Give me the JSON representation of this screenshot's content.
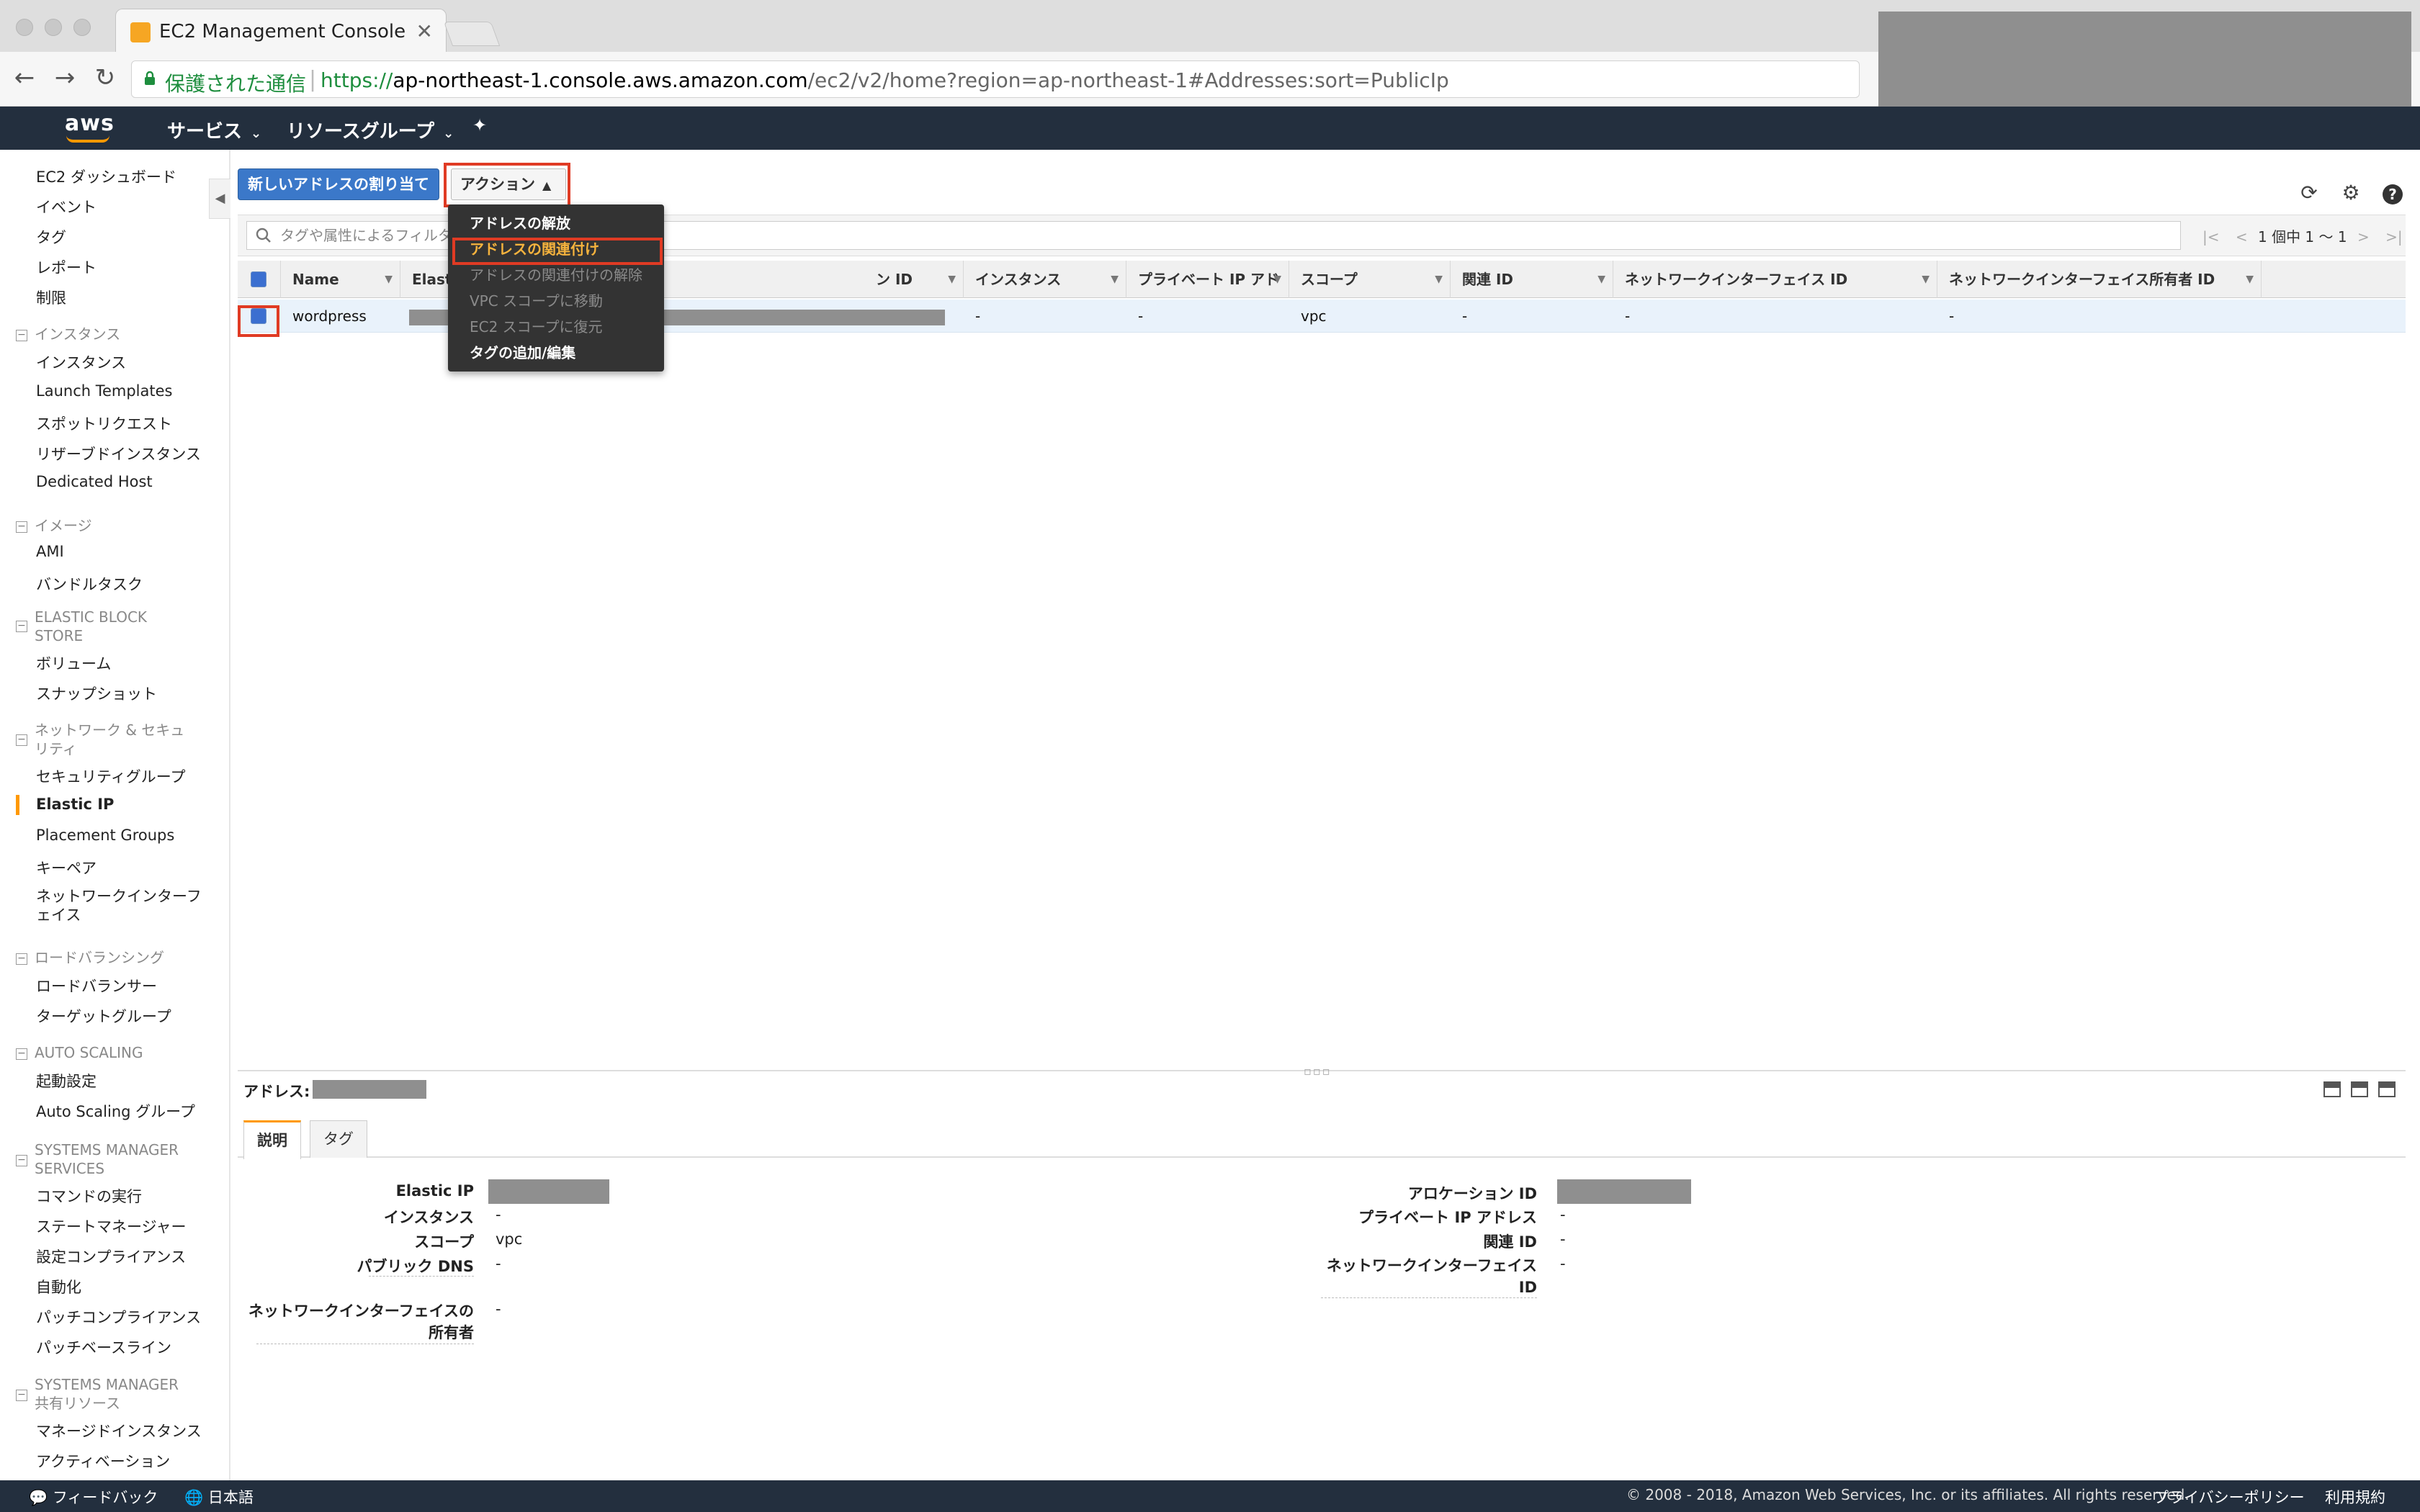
{
  "browser": {
    "tab_title": "EC2 Management Console",
    "secure_label": "保護された通信",
    "url_scheme": "https://",
    "url_host": "ap-northeast-1.console.aws.amazon.com",
    "url_path": "/ec2/v2/home?region=ap-northeast-1#Addresses:sort=PublicIp",
    "close_glyph": "✕"
  },
  "awsnav": {
    "logo": "aws",
    "services": "サービス",
    "resource_groups": "リソースグループ"
  },
  "sidebar": {
    "top_items": [
      "EC2 ダッシュボード",
      "イベント",
      "タグ",
      "レポート",
      "制限"
    ],
    "sections": [
      {
        "title": "インスタンス",
        "items": [
          "インスタンス",
          "Launch Templates",
          "スポットリクエスト",
          "リザーブドインスタンス",
          "Dedicated Host"
        ]
      },
      {
        "title": "イメージ",
        "items": [
          "AMI",
          "バンドルタスク"
        ]
      },
      {
        "title_lines": [
          "ELASTIC BLOCK",
          "STORE"
        ],
        "items": [
          "ボリューム",
          "スナップショット"
        ]
      },
      {
        "title_lines": [
          "ネットワーク & セキュ",
          "リティ"
        ],
        "items": [
          "セキュリティグループ",
          "Elastic IP",
          "Placement Groups",
          "キーペア"
        ],
        "extra_lines": [
          "ネットワークインターフ",
          "ェイス"
        ]
      },
      {
        "title": "ロードバランシング",
        "items": [
          "ロードバランサー",
          "ターゲットグループ"
        ]
      },
      {
        "title": "AUTO SCALING",
        "items": [
          "起動設定",
          "Auto Scaling グループ"
        ]
      },
      {
        "title_lines": [
          "SYSTEMS MANAGER",
          "SERVICES"
        ],
        "items": [
          "コマンドの実行",
          "ステートマネージャー",
          "設定コンプライアンス",
          "自動化",
          "パッチコンプライアンス",
          "パッチベースライン"
        ]
      },
      {
        "title_lines": [
          "SYSTEMS MANAGER",
          "共有リソース"
        ],
        "items": [
          "マネージドインスタンス",
          "アクティベーション"
        ]
      }
    ],
    "active_item": "Elastic IP"
  },
  "toolbar": {
    "new_address": "新しいアドレスの割り当て",
    "actions": "アクション"
  },
  "filter": {
    "placeholder": "タグや属性によるフィルタ",
    "pager_text": "1 個中 1 〜 1"
  },
  "table": {
    "headers": [
      "Name",
      "Elast",
      "ン ID",
      "インスタンス",
      "プライベート IP アド",
      "スコープ",
      "関連 ID",
      "ネットワークインターフェイス ID",
      "ネットワークインターフェイス所有者 ID"
    ],
    "row": {
      "name": "wordpress",
      "instance": "-",
      "private_ip": "-",
      "scope": "vpc",
      "association_id": "-",
      "eni_id": "-",
      "eni_owner": "-"
    }
  },
  "actions_menu": {
    "items": [
      {
        "label": "アドレスの解放",
        "state": "enabled"
      },
      {
        "label": "アドレスの関連付け",
        "state": "selected"
      },
      {
        "label": "アドレスの関連付けの解除",
        "state": "disabled"
      },
      {
        "label": "VPC スコープに移動",
        "state": "disabled"
      },
      {
        "label": "EC2 スコープに復元",
        "state": "disabled"
      },
      {
        "label": "タグの追加/編集",
        "state": "enabled"
      }
    ]
  },
  "detail": {
    "address_label": "アドレス:",
    "tabs": [
      "説明",
      "タグ"
    ],
    "left": [
      {
        "label": "Elastic IP",
        "value": ""
      },
      {
        "label": "インスタンス",
        "value": "-"
      },
      {
        "label": "スコープ",
        "value": "vpc"
      },
      {
        "label": "パブリック DNS",
        "value": "-"
      },
      {
        "label_lines": [
          "ネットワークインターフェイスの",
          "所有者"
        ],
        "value": "-"
      }
    ],
    "right": [
      {
        "label": "アロケーション ID",
        "value": ""
      },
      {
        "label": "プライベート IP アドレス",
        "value": "-"
      },
      {
        "label": "関連 ID",
        "value": "-"
      },
      {
        "label_lines": [
          "ネットワークインターフェイス",
          "ID"
        ],
        "value": "-"
      }
    ]
  },
  "footer": {
    "feedback": "フィードバック",
    "language": "日本語",
    "copyright": "© 2008 - 2018, Amazon Web Services, Inc. or its affiliates. All rights reserved.",
    "privacy": "プライバシーポリシー",
    "terms": "利用規約"
  },
  "colors": {
    "aws_nav": "#232f3e",
    "primary_button": "#3b78c9",
    "highlight": "#e03b24",
    "accent": "#f90",
    "selected_menu": "#f6b33d"
  }
}
